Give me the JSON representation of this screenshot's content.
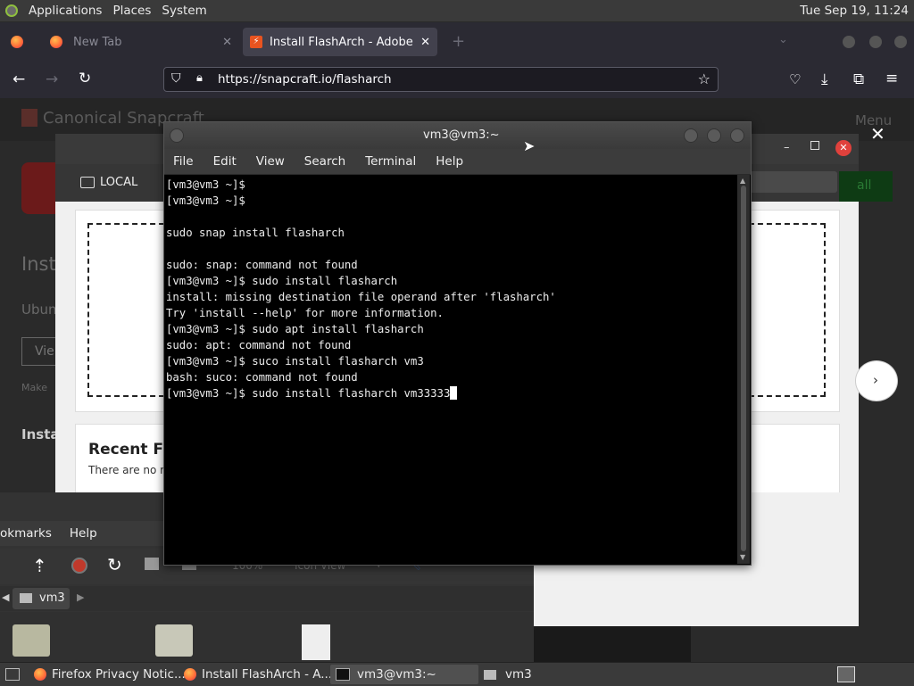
{
  "top_panel": {
    "menus": [
      "Applications",
      "Places",
      "System"
    ],
    "clock": "Tue Sep 19, 11:24"
  },
  "firefox": {
    "tabs": [
      {
        "label": "New Tab"
      },
      {
        "label": "Install FlashArch - Adobe Fl"
      }
    ],
    "url": "https://snapcraft.io/flasharch",
    "page": {
      "brand": "Canonical Snapcraft",
      "menu": "Menu",
      "dialog": {
        "local_label": "LOCAL",
        "recent_title": "Recent Fi",
        "recent_empty": "There are no re",
        "left_peek": [
          "Inst",
          "Ubun",
          "Vie",
          "Make",
          "Insta"
        ],
        "install_btn": "all"
      }
    }
  },
  "terminal": {
    "title": "vm3@vm3:~",
    "menus": [
      "File",
      "Edit",
      "View",
      "Search",
      "Terminal",
      "Help"
    ],
    "lines": [
      "[vm3@vm3 ~]$",
      "[vm3@vm3 ~]$",
      "",
      "sudo snap install flasharch",
      "",
      "sudo: snap: command not found",
      "[vm3@vm3 ~]$ sudo install flasharch",
      "install: missing destination file operand after 'flasharch'",
      "Try 'install --help' for more information.",
      "[vm3@vm3 ~]$ sudo apt install flasharch",
      "sudo: apt: command not found",
      "[vm3@vm3 ~]$ suco install flasharch vm3",
      "bash: suco: command not found"
    ],
    "current_line": "[vm3@vm3 ~]$ sudo install flasharch vm33333"
  },
  "file_manager": {
    "menus": [
      "okmarks",
      "Help"
    ],
    "zoom": "100%",
    "view_mode": "Icon View",
    "path": "vm3"
  },
  "taskbar": {
    "items": [
      {
        "label": "Firefox Privacy Notic..."
      },
      {
        "label": "Install FlashArch - A..."
      },
      {
        "label": "vm3@vm3:~"
      },
      {
        "label": "vm3"
      }
    ]
  },
  "colors": {
    "terminal_bg": "#000000",
    "close_red": "#e0413c",
    "firefox_bar": "#2b2a33"
  }
}
